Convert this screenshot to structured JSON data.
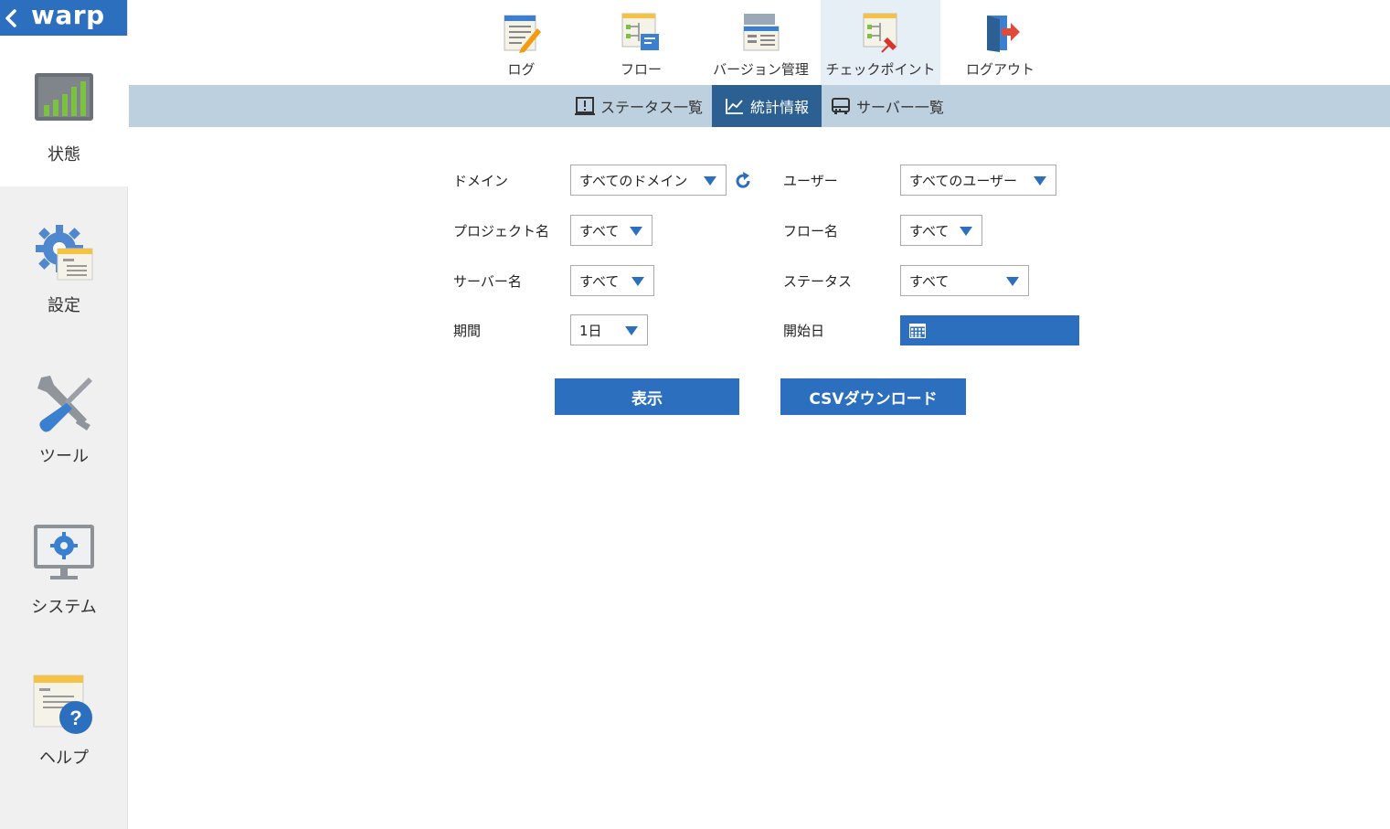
{
  "brand": {
    "name": "warp"
  },
  "sidebar": {
    "items": [
      {
        "label": "状態",
        "icon": "status-chart-icon",
        "active": true
      },
      {
        "label": "設定",
        "icon": "settings-gear-icon"
      },
      {
        "label": "ツール",
        "icon": "tools-icon"
      },
      {
        "label": "システム",
        "icon": "system-monitor-icon"
      },
      {
        "label": "ヘルプ",
        "icon": "help-icon"
      }
    ]
  },
  "topnav": {
    "items": [
      {
        "label": "ログ",
        "icon": "log-icon"
      },
      {
        "label": "フロー",
        "icon": "flow-icon"
      },
      {
        "label": "バージョン管理",
        "icon": "version-icon"
      },
      {
        "label": "チェックポイント",
        "icon": "checkpoint-icon",
        "active": true
      },
      {
        "label": "ログアウト",
        "icon": "logout-icon"
      }
    ]
  },
  "subnav": {
    "tabs": [
      {
        "label": "ステータス一覧",
        "icon": "alert-box-icon"
      },
      {
        "label": "統計情報",
        "icon": "line-chart-icon",
        "active": true
      },
      {
        "label": "サーバー一覧",
        "icon": "server-icon"
      }
    ]
  },
  "form": {
    "domain": {
      "label": "ドメイン",
      "value": "すべてのドメイン"
    },
    "user": {
      "label": "ユーザー",
      "value": "すべてのユーザー"
    },
    "project": {
      "label": "プロジェクト名",
      "value": "すべて"
    },
    "flow": {
      "label": "フロー名",
      "value": "すべて"
    },
    "server": {
      "label": "サーバー名",
      "value": "すべて"
    },
    "status": {
      "label": "ステータス",
      "value": "すべて"
    },
    "period": {
      "label": "期間",
      "value": "1日"
    },
    "start_date": {
      "label": "開始日",
      "value": ""
    }
  },
  "buttons": {
    "show": "表示",
    "csv": "CSVダウンロード"
  },
  "colors": {
    "accent": "#2c6fbf",
    "subnav_bg": "#bcd0df",
    "subnav_active": "#2c5f92",
    "sidebar_bg": "#f0f0f0"
  }
}
